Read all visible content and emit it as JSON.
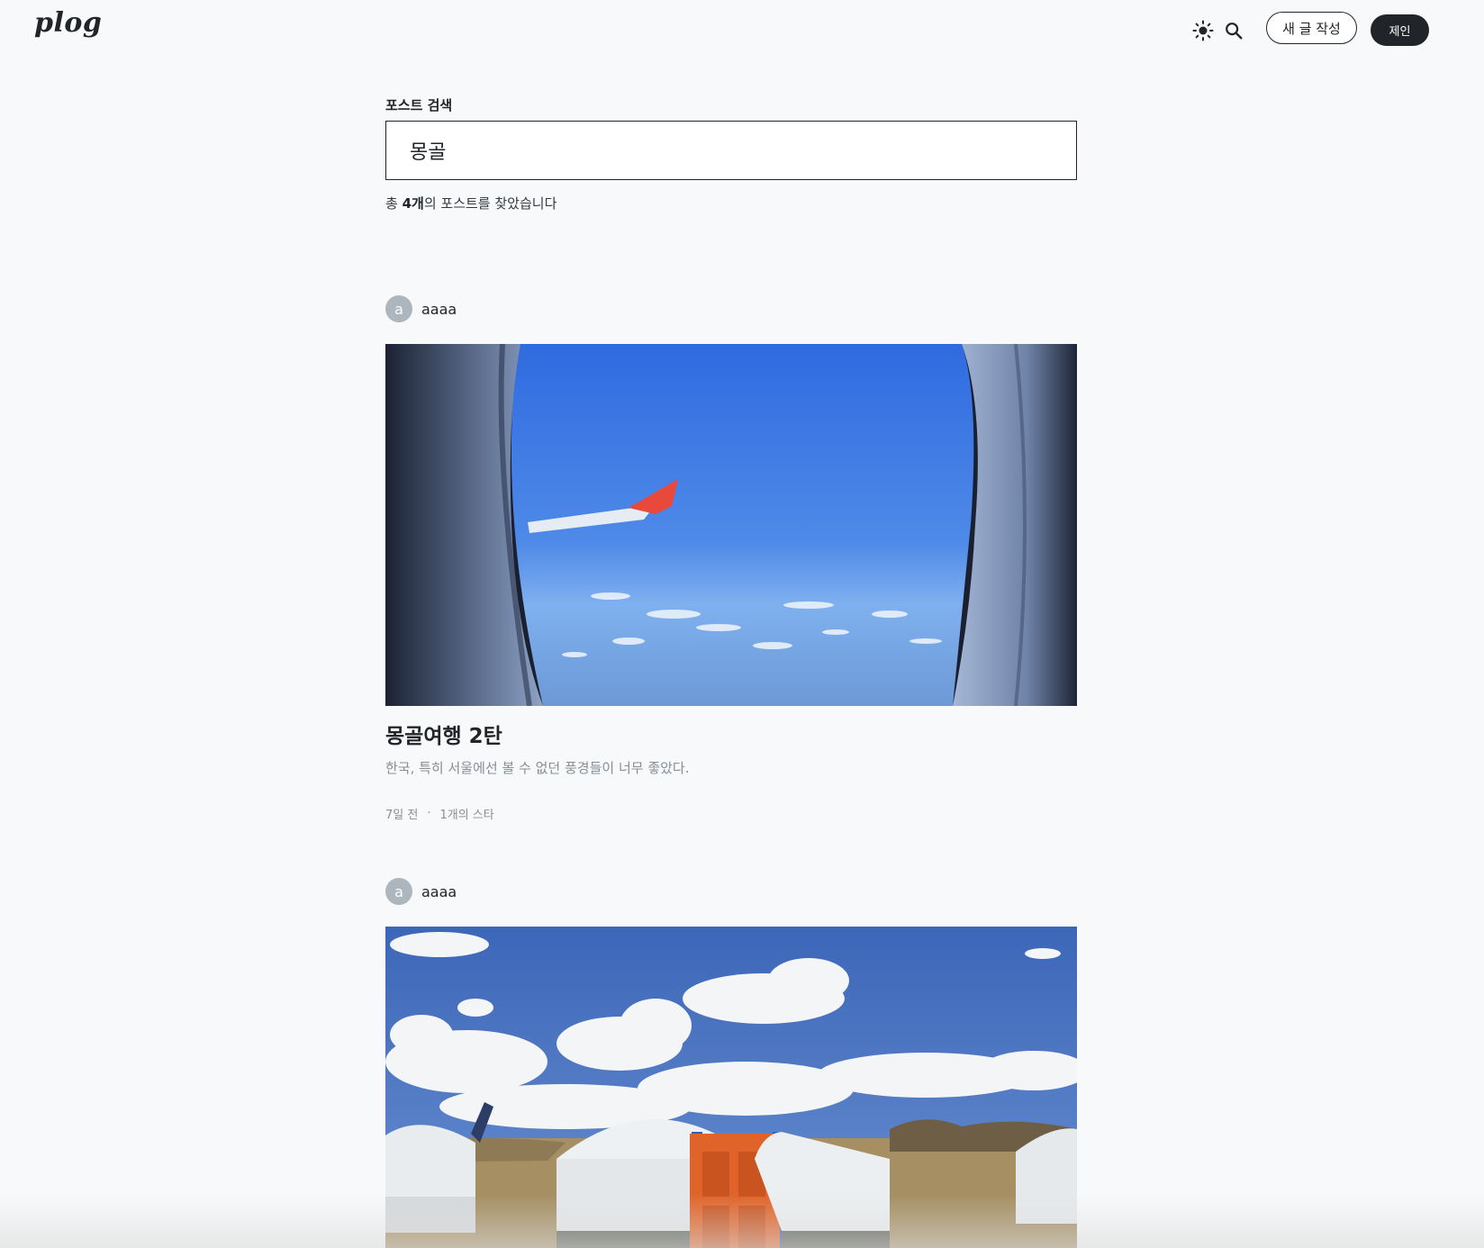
{
  "header": {
    "logo": "plog",
    "write_button": "새 글 작성",
    "user_button": "제인"
  },
  "search": {
    "label": "포스트 검색",
    "value": "몽골",
    "result_prefix": "총 ",
    "result_count": "4개",
    "result_suffix": "의 포스트를 찾았습니다"
  },
  "posts": [
    {
      "author_initial": "a",
      "author": "aaaa",
      "title": "몽골여행 2탄",
      "description": "한국, 특히 서울에선 볼 수 없던 풍경들이 너무 좋았다.",
      "date": "7일 전",
      "separator": "·",
      "stars": "1개의 스타"
    },
    {
      "author_initial": "a",
      "author": "aaaa"
    }
  ],
  "colors": {
    "background": "#f8f9fa",
    "text": "#212529",
    "muted": "#868e96",
    "avatar": "#adb5bd"
  }
}
